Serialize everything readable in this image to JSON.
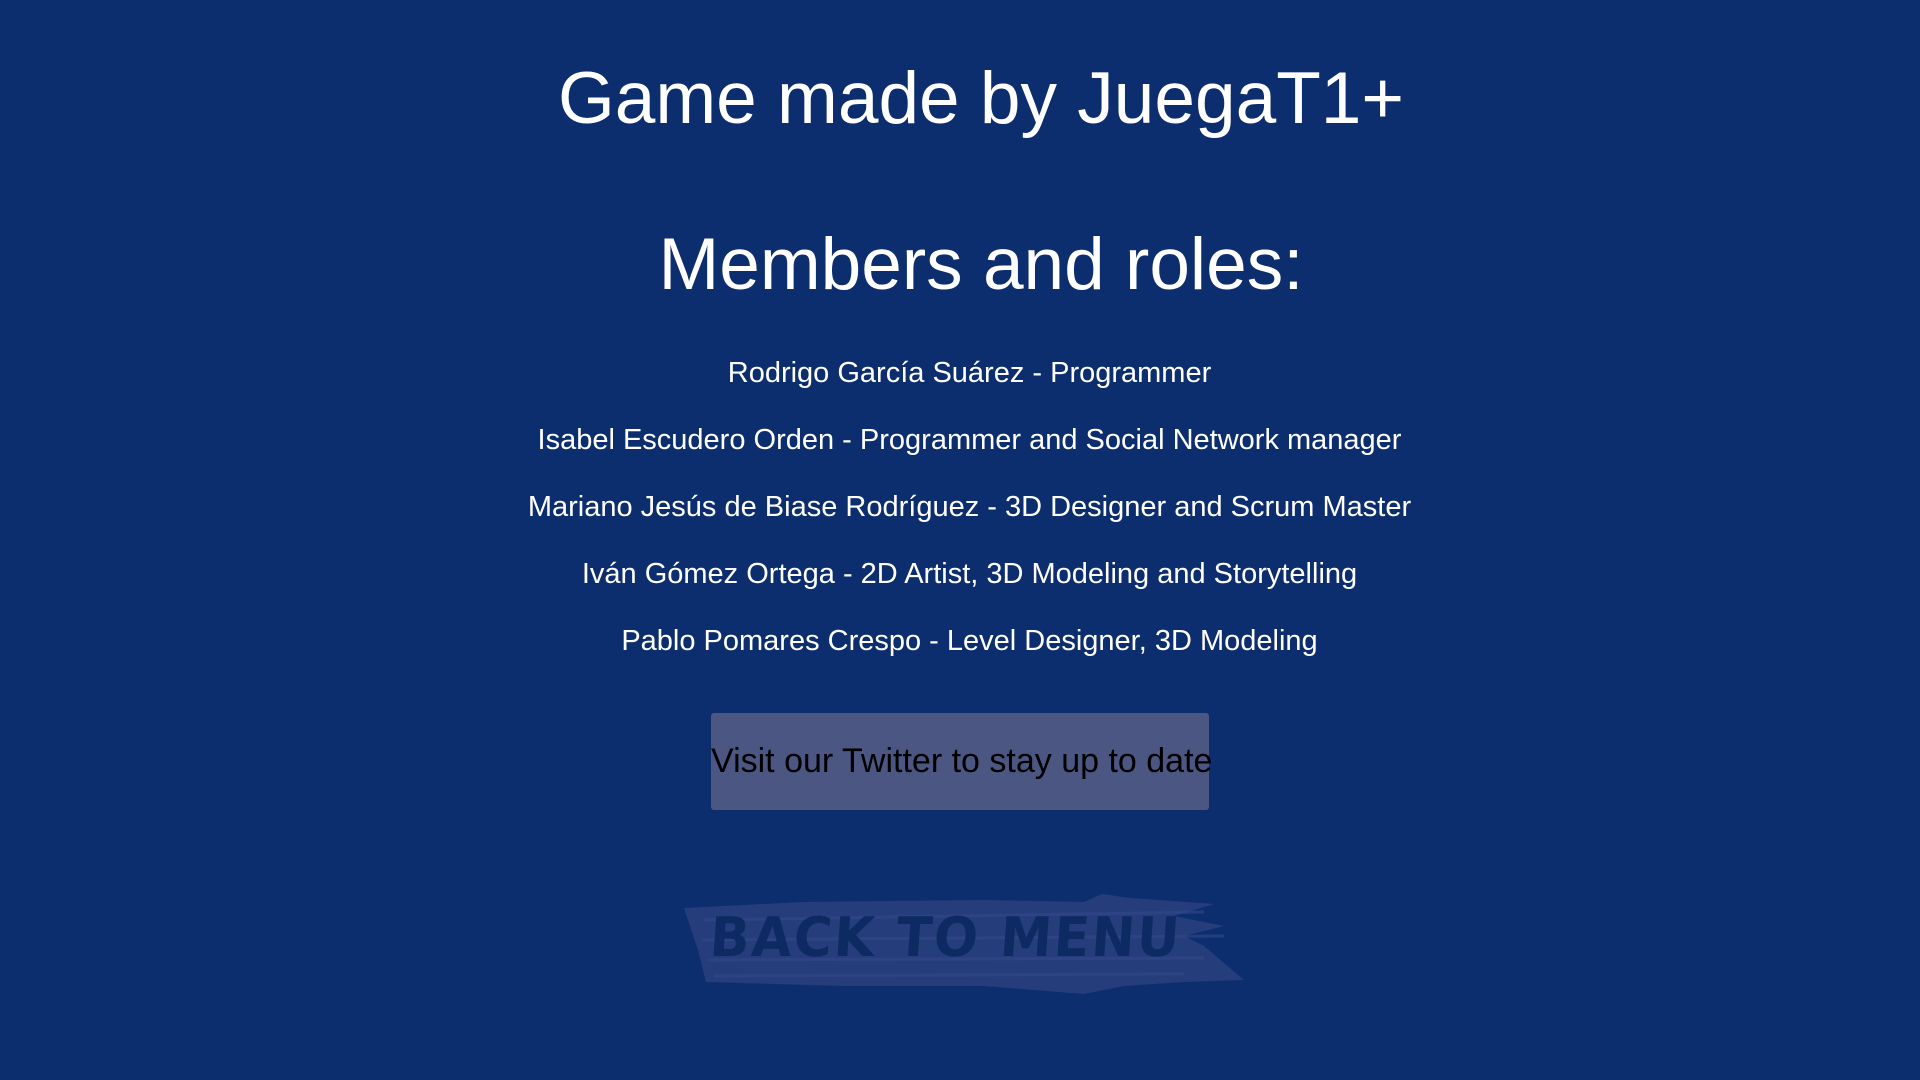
{
  "credits": {
    "title": "Game made by JuegaT1+",
    "members_heading": "Members and roles:",
    "members": [
      "Rodrigo García Suárez - Programmer",
      "Isabel Escudero Orden - Programmer and Social Network manager",
      "Mariano Jesús de Biase Rodríguez - 3D Designer and Scrum Master",
      "Iván Gómez Ortega - 2D Artist, 3D Modeling and Storytelling",
      "Pablo Pomares Crespo - Level Designer, 3D Modeling"
    ]
  },
  "buttons": {
    "twitter_label": "Visit our Twitter to stay up to date",
    "back_label": "BACK TO MENU"
  },
  "colors": {
    "background": "#0d2e6e",
    "text": "#ffffff",
    "twitter_button": "#4b5682",
    "back_brush": "#2b3f7e"
  }
}
